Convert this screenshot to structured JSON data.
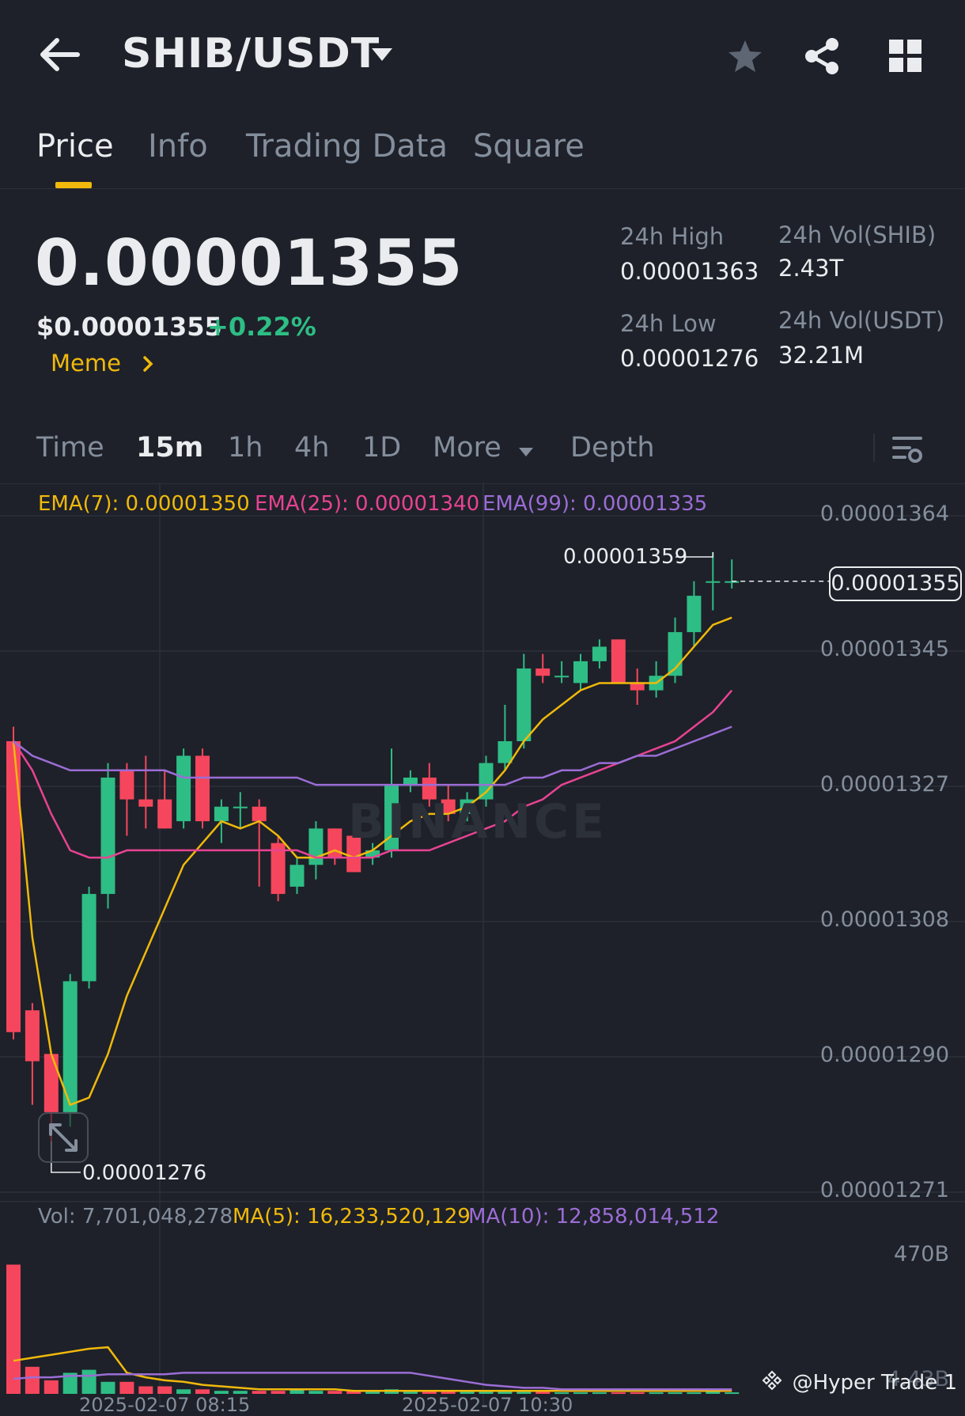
{
  "header": {
    "pair": "SHIB/USDT"
  },
  "tabs": [
    {
      "label": "Price",
      "active": true
    },
    {
      "label": "Info",
      "active": false
    },
    {
      "label": "Trading Data",
      "active": false
    },
    {
      "label": "Square",
      "active": false
    }
  ],
  "price": {
    "last": "0.00001355",
    "usd": "$0.00001355",
    "change": "+0.22%",
    "tag": "Meme"
  },
  "stats": {
    "high_label": "24h High",
    "high_value": "0.00001363",
    "low_label": "24h Low",
    "low_value": "0.00001276",
    "vol_base_label": "24h Vol(SHIB)",
    "vol_base_value": "2.43T",
    "vol_quote_label": "24h Vol(USDT)",
    "vol_quote_value": "32.21M"
  },
  "intervals": {
    "time": "Time",
    "i15m": "15m",
    "i1h": "1h",
    "i4h": "4h",
    "i1d": "1D",
    "more": "More",
    "depth": "Depth"
  },
  "indicators": {
    "ema7": "EMA(7): 0.00001350",
    "ema25": "EMA(25): 0.00001340",
    "ema99": "EMA(99): 0.00001335",
    "vol": "Vol: 7,701,048,278",
    "ma5": "MA(5): 16,233,520,129",
    "ma10": "MA(10): 12,858,014,512"
  },
  "chart_labels": {
    "current_price": "0.00001355",
    "high_marker": "0.00001359",
    "low_marker": "0.00001276",
    "watermark": "BINANCE",
    "credit": "@Hyper Trade 1",
    "vol_axis_top": "470B",
    "vol_axis_bottom": "4.43B",
    "x_ticks": [
      "2025-02-07 08:15",
      "2025-02-07 10:30"
    ]
  },
  "colors": {
    "up": "#2ebd85",
    "down": "#f6465d",
    "ema7": "#f0b90b",
    "ema25": "#e84393",
    "ema99": "#9b6dd6",
    "accent": "#f0b90b"
  },
  "chart_data": {
    "type": "candlestick",
    "y_axis_labels": [
      "0.00001364",
      "0.00001345",
      "0.00001327",
      "0.00001308",
      "0.00001290",
      "0.00001271"
    ],
    "ylim": [
      1.271e-05,
      1.364e-05
    ],
    "grid": true,
    "candles": [
      {
        "o": 1.333e-05,
        "h": 1.335e-05,
        "l": 1.292e-05,
        "c": 1.293e-05
      },
      {
        "o": 1.296e-05,
        "h": 1.297e-05,
        "l": 1.283e-05,
        "c": 1.289e-05
      },
      {
        "o": 1.29e-05,
        "h": 1.29e-05,
        "l": 1.278e-05,
        "c": 1.282e-05
      },
      {
        "o": 1.282e-05,
        "h": 1.301e-05,
        "l": 1.28e-05,
        "c": 1.3e-05
      },
      {
        "o": 1.3e-05,
        "h": 1.313e-05,
        "l": 1.299e-05,
        "c": 1.312e-05
      },
      {
        "o": 1.312e-05,
        "h": 1.33e-05,
        "l": 1.31e-05,
        "c": 1.328e-05
      },
      {
        "o": 1.329e-05,
        "h": 1.33e-05,
        "l": 1.32e-05,
        "c": 1.325e-05
      },
      {
        "o": 1.325e-05,
        "h": 1.331e-05,
        "l": 1.321e-05,
        "c": 1.324e-05
      },
      {
        "o": 1.325e-05,
        "h": 1.329e-05,
        "l": 1.321e-05,
        "c": 1.321e-05
      },
      {
        "o": 1.322e-05,
        "h": 1.332e-05,
        "l": 1.321e-05,
        "c": 1.331e-05
      },
      {
        "o": 1.331e-05,
        "h": 1.332e-05,
        "l": 1.321e-05,
        "c": 1.322e-05
      },
      {
        "o": 1.322e-05,
        "h": 1.325e-05,
        "l": 1.319e-05,
        "c": 1.324e-05
      },
      {
        "o": 1.324e-05,
        "h": 1.326e-05,
        "l": 1.321e-05,
        "c": 1.324e-05
      },
      {
        "o": 1.324e-05,
        "h": 1.325e-05,
        "l": 1.313e-05,
        "c": 1.322e-05
      },
      {
        "o": 1.319e-05,
        "h": 1.32e-05,
        "l": 1.311e-05,
        "c": 1.312e-05
      },
      {
        "o": 1.313e-05,
        "h": 1.317e-05,
        "l": 1.312e-05,
        "c": 1.316e-05
      },
      {
        "o": 1.316e-05,
        "h": 1.322e-05,
        "l": 1.314e-05,
        "c": 1.321e-05
      },
      {
        "o": 1.321e-05,
        "h": 1.321e-05,
        "l": 1.316e-05,
        "c": 1.317e-05
      },
      {
        "o": 1.32e-05,
        "h": 1.321e-05,
        "l": 1.315e-05,
        "c": 1.315e-05
      },
      {
        "o": 1.317e-05,
        "h": 1.319e-05,
        "l": 1.316e-05,
        "c": 1.318e-05
      },
      {
        "o": 1.318e-05,
        "h": 1.332e-05,
        "l": 1.317e-05,
        "c": 1.327e-05
      },
      {
        "o": 1.327e-05,
        "h": 1.329e-05,
        "l": 1.326e-05,
        "c": 1.328e-05
      },
      {
        "o": 1.328e-05,
        "h": 1.33e-05,
        "l": 1.324e-05,
        "c": 1.325e-05
      },
      {
        "o": 1.325e-05,
        "h": 1.327e-05,
        "l": 1.322e-05,
        "c": 1.323e-05
      },
      {
        "o": 1.323e-05,
        "h": 1.326e-05,
        "l": 1.322e-05,
        "c": 1.325e-05
      },
      {
        "o": 1.325e-05,
        "h": 1.331e-05,
        "l": 1.324e-05,
        "c": 1.33e-05
      },
      {
        "o": 1.33e-05,
        "h": 1.338e-05,
        "l": 1.329e-05,
        "c": 1.333e-05
      },
      {
        "o": 1.333e-05,
        "h": 1.345e-05,
        "l": 1.332e-05,
        "c": 1.343e-05
      },
      {
        "o": 1.343e-05,
        "h": 1.345e-05,
        "l": 1.341e-05,
        "c": 1.342e-05
      },
      {
        "o": 1.342e-05,
        "h": 1.344e-05,
        "l": 1.341e-05,
        "c": 1.342e-05
      },
      {
        "o": 1.341e-05,
        "h": 1.345e-05,
        "l": 1.34e-05,
        "c": 1.344e-05
      },
      {
        "o": 1.344e-05,
        "h": 1.347e-05,
        "l": 1.343e-05,
        "c": 1.346e-05
      },
      {
        "o": 1.347e-05,
        "h": 1.347e-05,
        "l": 1.341e-05,
        "c": 1.341e-05
      },
      {
        "o": 1.341e-05,
        "h": 1.343e-05,
        "l": 1.338e-05,
        "c": 1.34e-05
      },
      {
        "o": 1.34e-05,
        "h": 1.344e-05,
        "l": 1.339e-05,
        "c": 1.342e-05
      },
      {
        "o": 1.342e-05,
        "h": 1.35e-05,
        "l": 1.341e-05,
        "c": 1.348e-05
      },
      {
        "o": 1.348e-05,
        "h": 1.355e-05,
        "l": 1.346e-05,
        "c": 1.353e-05
      },
      {
        "o": 1.355e-05,
        "h": 1.359e-05,
        "l": 1.351e-05,
        "c": 1.355e-05
      },
      {
        "o": 1.355e-05,
        "h": 1.358e-05,
        "l": 1.354e-05,
        "c": 1.355e-05
      }
    ],
    "series": [
      {
        "name": "EMA(7)",
        "values": [
          1.333e-05,
          1.306e-05,
          1.29e-05,
          1.283e-05,
          1.284e-05,
          1.29e-05,
          1.298e-05,
          1.304e-05,
          1.31e-05,
          1.316e-05,
          1.319e-05,
          1.322e-05,
          1.321e-05,
          1.322e-05,
          1.32e-05,
          1.317e-05,
          1.317e-05,
          1.318e-05,
          1.317e-05,
          1.318e-05,
          1.32e-05,
          1.322e-05,
          1.323e-05,
          1.323e-05,
          1.324e-05,
          1.326e-05,
          1.329e-05,
          1.333e-05,
          1.336e-05,
          1.338e-05,
          1.34e-05,
          1.341e-05,
          1.341e-05,
          1.341e-05,
          1.341e-05,
          1.343e-05,
          1.346e-05,
          1.349e-05,
          1.35e-05
        ]
      },
      {
        "name": "EMA(25)",
        "values": [
          1.333e-05,
          1.329e-05,
          1.323e-05,
          1.318e-05,
          1.317e-05,
          1.317e-05,
          1.318e-05,
          1.318e-05,
          1.318e-05,
          1.318e-05,
          1.318e-05,
          1.318e-05,
          1.318e-05,
          1.318e-05,
          1.318e-05,
          1.318e-05,
          1.317e-05,
          1.317e-05,
          1.317e-05,
          1.317e-05,
          1.318e-05,
          1.318e-05,
          1.318e-05,
          1.319e-05,
          1.32e-05,
          1.321e-05,
          1.322e-05,
          1.324e-05,
          1.325e-05,
          1.327e-05,
          1.328e-05,
          1.329e-05,
          1.33e-05,
          1.331e-05,
          1.332e-05,
          1.333e-05,
          1.335e-05,
          1.337e-05,
          1.34e-05
        ]
      },
      {
        "name": "EMA(99)",
        "values": [
          1.333e-05,
          1.331e-05,
          1.33e-05,
          1.329e-05,
          1.329e-05,
          1.329e-05,
          1.329e-05,
          1.329e-05,
          1.329e-05,
          1.328e-05,
          1.328e-05,
          1.328e-05,
          1.328e-05,
          1.328e-05,
          1.328e-05,
          1.328e-05,
          1.327e-05,
          1.327e-05,
          1.327e-05,
          1.327e-05,
          1.327e-05,
          1.327e-05,
          1.327e-05,
          1.327e-05,
          1.327e-05,
          1.327e-05,
          1.327e-05,
          1.328e-05,
          1.328e-05,
          1.329e-05,
          1.329e-05,
          1.33e-05,
          1.33e-05,
          1.331e-05,
          1.331e-05,
          1.332e-05,
          1.333e-05,
          1.334e-05,
          1.335e-05
        ]
      }
    ],
    "volume": {
      "values_b": [
        86,
        18,
        9,
        14,
        16,
        8,
        8,
        5,
        5,
        3,
        3,
        2,
        2,
        2,
        2,
        3,
        2,
        2,
        2,
        2,
        3,
        2,
        2,
        2,
        2,
        2,
        2,
        2,
        2,
        1,
        1,
        1,
        1,
        1,
        1,
        1,
        1,
        2,
        1
      ],
      "ma5_b": [
        22,
        24,
        26,
        28,
        30,
        31,
        14,
        11,
        9,
        8,
        6,
        5,
        4,
        3,
        3,
        3,
        3,
        3,
        2,
        2,
        2,
        2,
        2,
        2,
        2,
        2,
        2,
        2,
        2,
        2,
        2,
        2,
        2,
        2,
        2,
        2,
        2,
        2,
        2
      ],
      "ma10_b": [
        10,
        11,
        11,
        12,
        12,
        13,
        13,
        13,
        13,
        14,
        14,
        14,
        14,
        14,
        14,
        14,
        14,
        14,
        14,
        14,
        14,
        14,
        12,
        10,
        8,
        6,
        5,
        4,
        4,
        3,
        3,
        3,
        3,
        3,
        3,
        3,
        3,
        3,
        3
      ]
    }
  }
}
